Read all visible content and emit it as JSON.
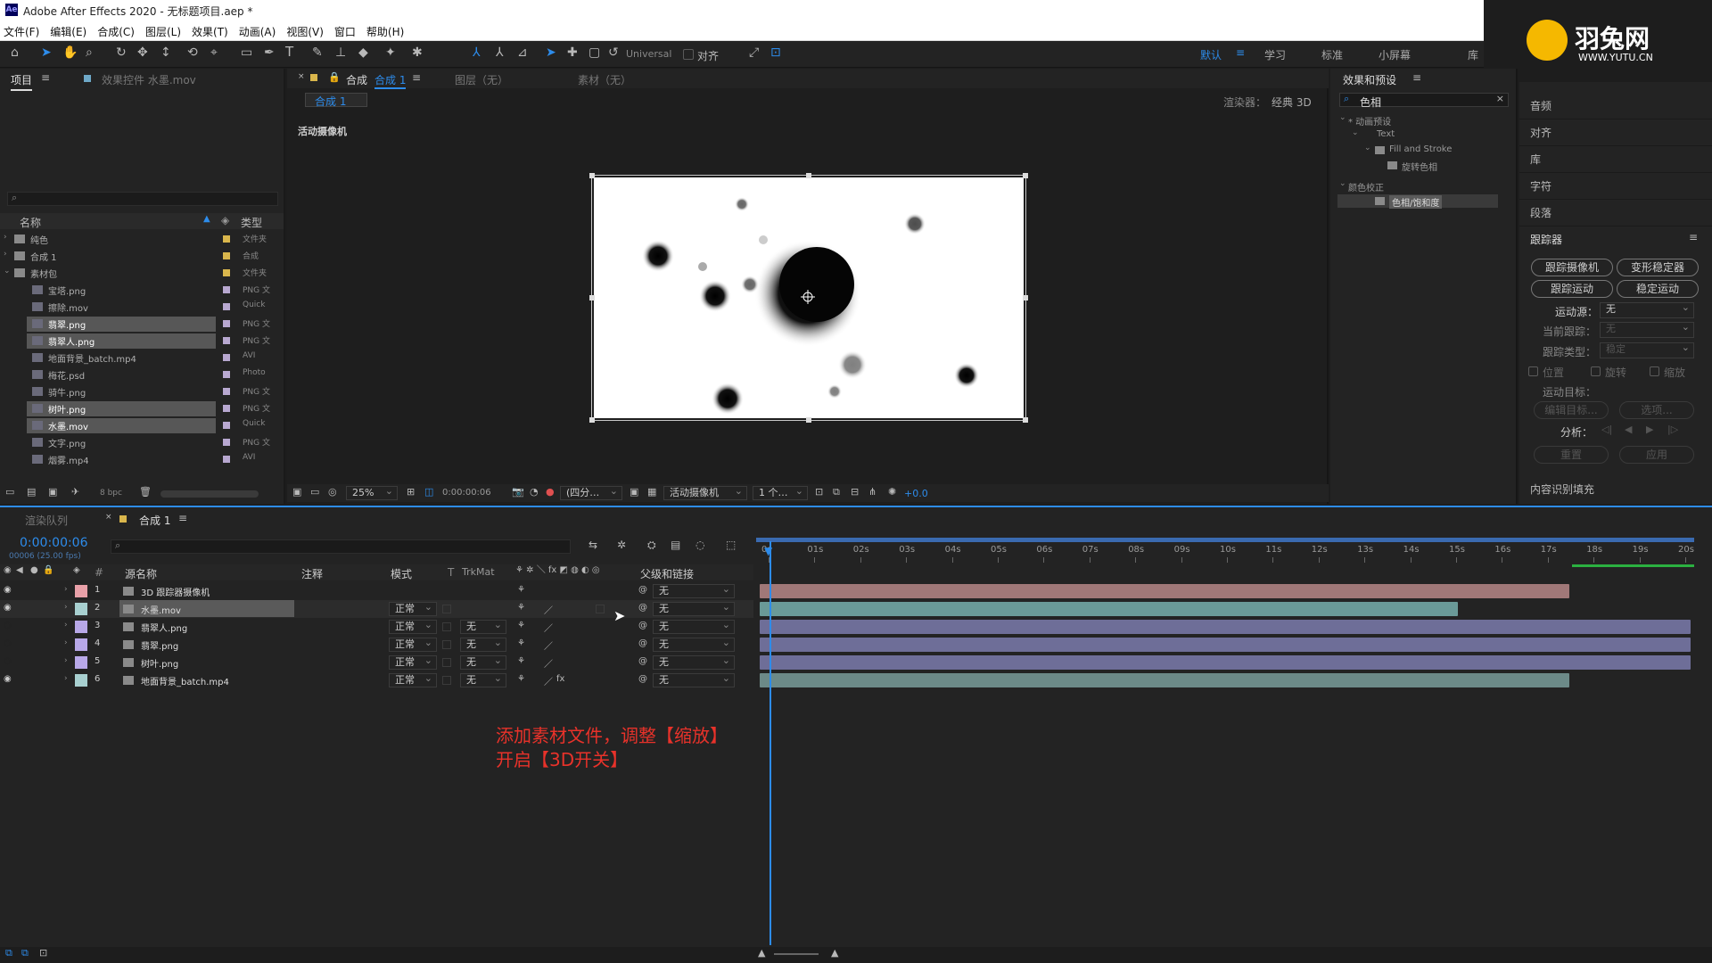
{
  "title": "Adobe After Effects 2020 - 无标题项目.aep *",
  "menu": [
    "文件(F)",
    "编辑(E)",
    "合成(C)",
    "图层(L)",
    "效果(T)",
    "动画(A)",
    "视图(V)",
    "窗口",
    "帮助(H)"
  ],
  "toolbar": {
    "universal": "Universal",
    "align": "对齐"
  },
  "workspaces": [
    "默认",
    "学习",
    "标准",
    "小屏幕",
    "库"
  ],
  "logo": {
    "name": "羽兔网",
    "url": "WWW.YUTU.CN"
  },
  "project": {
    "tab": "项目",
    "effects_tab": "效果控件 水墨.mov",
    "col_name": "名称",
    "col_type": "类型",
    "bpc": "8 bpc",
    "items": [
      {
        "name": "纯色",
        "type": "文件夹",
        "color": "#d9b64c",
        "sel": false,
        "lvl": 0
      },
      {
        "name": "合成 1",
        "type": "合成",
        "color": "#d9b64c",
        "sel": false,
        "lvl": 0
      },
      {
        "name": "素材包",
        "type": "文件夹",
        "color": "#d9b64c",
        "sel": false,
        "lvl": 0
      },
      {
        "name": "宝塔.png",
        "type": "PNG 文",
        "color": "#b8a8d0",
        "sel": false,
        "lvl": 1
      },
      {
        "name": "擦除.mov",
        "type": "Quick",
        "color": "#b8a8d0",
        "sel": false,
        "lvl": 1
      },
      {
        "name": "翡翠.png",
        "type": "PNG 文",
        "color": "#b8a8d0",
        "sel": true,
        "lvl": 1
      },
      {
        "name": "翡翠人.png",
        "type": "PNG 文",
        "color": "#b8a8d0",
        "sel": true,
        "lvl": 1
      },
      {
        "name": "地面背景_batch.mp4",
        "type": "AVI",
        "color": "#b8a8d0",
        "sel": false,
        "lvl": 1
      },
      {
        "name": "梅花.psd",
        "type": "Photo",
        "color": "#b8a8d0",
        "sel": false,
        "lvl": 1
      },
      {
        "name": "骑牛.png",
        "type": "PNG 文",
        "color": "#b8a8d0",
        "sel": false,
        "lvl": 1
      },
      {
        "name": "树叶.png",
        "type": "PNG 文",
        "color": "#b8a8d0",
        "sel": true,
        "lvl": 1
      },
      {
        "name": "水墨.mov",
        "type": "Quick",
        "color": "#b8a8d0",
        "sel": true,
        "lvl": 1
      },
      {
        "name": "文字.png",
        "type": "PNG 文",
        "color": "#b8a8d0",
        "sel": false,
        "lvl": 1
      },
      {
        "name": "烟雾.mp4",
        "type": "AVI",
        "color": "#b8a8d0",
        "sel": false,
        "lvl": 1
      }
    ]
  },
  "comp": {
    "tab_prefix": "合成",
    "tab_name": "合成 1",
    "layer_tab": "图层（无）",
    "footage_tab": "素材（无）",
    "subtab": "合成 1",
    "renderer_label": "渲染器：",
    "renderer": "经典 3D",
    "camera_label": "活动摄像机",
    "zoom": "25%",
    "timecode": "0:00:00:06",
    "resolution": "(四分…",
    "view_camera": "活动摄像机",
    "views": "1 个…",
    "exposure": "+0.0"
  },
  "effects": {
    "title": "效果和预设",
    "search": "色相",
    "tree": [
      {
        "t": "* 动画预设",
        "lvl": 0
      },
      {
        "t": "Text",
        "lvl": 1
      },
      {
        "t": "Fill and Stroke",
        "lvl": 2
      },
      {
        "t": "旋转色相",
        "lvl": 3
      },
      {
        "t": "颜色校正",
        "lvl": 0
      },
      {
        "t": "色相/饱和度",
        "lvl": 2
      }
    ]
  },
  "right": {
    "items": [
      "音频",
      "对齐",
      "库",
      "字符",
      "段落"
    ],
    "tracker": {
      "title": "跟踪器",
      "btn_camera": "跟踪摄像机",
      "btn_warp": "变形稳定器",
      "btn_motion": "跟踪运动",
      "btn_stable": "稳定运动",
      "source_label": "运动源：",
      "source": "无",
      "current_label": "当前跟踪：",
      "current": "无",
      "type_label": "跟踪类型：",
      "type": "稳定",
      "opt_pos": "位置",
      "opt_rot": "旋转",
      "opt_scale": "缩放",
      "target_label": "运动目标：",
      "edit_target": "编辑目标...",
      "options": "选项...",
      "analyze": "分析：",
      "reset": "重置",
      "apply": "应用"
    },
    "content_fill": "内容识别填充"
  },
  "timeline": {
    "render_tab": "渲染队列",
    "comp_tab": "合成 1",
    "timecode": "0:00:00:06",
    "fps": "00006 (25.00 fps)",
    "headers": {
      "source": "源名称",
      "comment": "注释",
      "mode": "模式",
      "t": "T",
      "trkmat": "TrkMat",
      "parent": "父级和链接"
    },
    "ruler": [
      "0s",
      "01s",
      "02s",
      "03s",
      "04s",
      "05s",
      "06s",
      "07s",
      "08s",
      "09s",
      "10s",
      "11s",
      "12s",
      "13s",
      "14s",
      "15s",
      "16s",
      "17s",
      "18s",
      "19s",
      "20s"
    ],
    "layers": [
      {
        "num": "1",
        "name": "3D 跟踪器摄像机",
        "color": "#e8a0a8",
        "mode": "",
        "trk": "",
        "parent": "无",
        "barcolor": "#a07878",
        "barend": 0.87
      },
      {
        "num": "2",
        "name": "水墨.mov",
        "color": "#a8d0d0",
        "mode": "正常",
        "trk": "",
        "parent": "无",
        "barcolor": "#6a9a98",
        "barend": 0.75
      },
      {
        "num": "3",
        "name": "翡翠人.png",
        "color": "#b8a8e8",
        "mode": "正常",
        "trk": "无",
        "parent": "无",
        "barcolor": "#6e6e98",
        "barend": 1.0
      },
      {
        "num": "4",
        "name": "翡翠.png",
        "color": "#b8a8e8",
        "mode": "正常",
        "trk": "无",
        "parent": "无",
        "barcolor": "#6e6e98",
        "barend": 1.0
      },
      {
        "num": "5",
        "name": "树叶.png",
        "color": "#b8a8e8",
        "mode": "正常",
        "trk": "无",
        "parent": "无",
        "barcolor": "#6e6e98",
        "barend": 1.0
      },
      {
        "num": "6",
        "name": "地面背景_batch.mp4",
        "color": "#a8d0d0",
        "mode": "正常",
        "trk": "无",
        "parent": "无",
        "barcolor": "#6c8a88",
        "barend": 0.87
      }
    ]
  },
  "annotation": {
    "line1": "添加素材文件，调整【缩放】",
    "line2": "开启【3D开关】"
  },
  "colors": {
    "accent": "#2d8ceb",
    "annotation": "#e8322a",
    "panel": "#232323"
  }
}
